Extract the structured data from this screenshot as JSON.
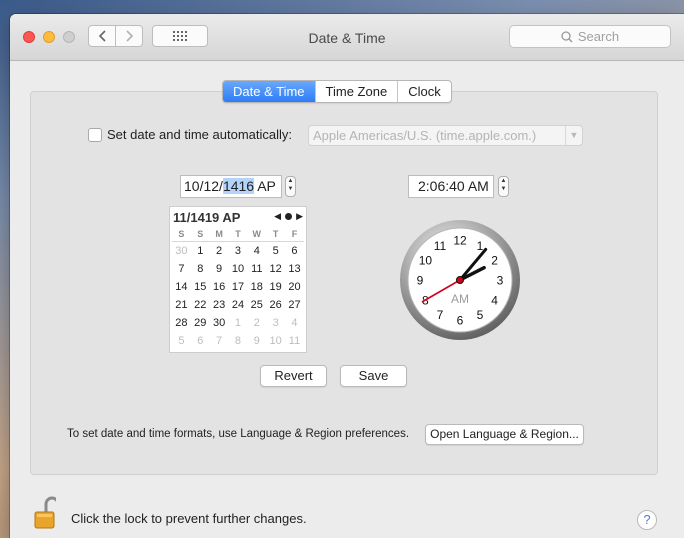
{
  "window": {
    "title": "Date & Time"
  },
  "toolbar": {
    "search_placeholder": "Search"
  },
  "tabs": [
    {
      "label": "Date & Time",
      "active": true
    },
    {
      "label": "Time Zone",
      "active": false
    },
    {
      "label": "Clock",
      "active": false
    }
  ],
  "auto": {
    "checkbox_label": "Set date and time automatically:",
    "checked": false,
    "server": "Apple Americas/U.S. (time.apple.com.)"
  },
  "date": {
    "field_prefix": "10/12/",
    "field_selected": "1416",
    "field_suffix": " AP"
  },
  "time": {
    "field": "2:06:40 AM"
  },
  "calendar": {
    "header": "11/1419 AP",
    "weekdays": [
      "S",
      "S",
      "M",
      "T",
      "W",
      "T",
      "F"
    ],
    "weeks": [
      [
        "30",
        "1",
        "2",
        "3",
        "4",
        "5",
        "6"
      ],
      [
        "7",
        "8",
        "9",
        "10",
        "11",
        "12",
        "13"
      ],
      [
        "14",
        "15",
        "16",
        "17",
        "18",
        "19",
        "20"
      ],
      [
        "21",
        "22",
        "23",
        "24",
        "25",
        "26",
        "27"
      ],
      [
        "28",
        "29",
        "30",
        "1",
        "2",
        "3",
        "4"
      ],
      [
        "5",
        "6",
        "7",
        "8",
        "9",
        "10",
        "11"
      ]
    ],
    "dimmed": [
      [
        0
      ],
      [],
      [],
      [],
      [
        3,
        4,
        5,
        6
      ],
      [
        0,
        1,
        2,
        3,
        4,
        5,
        6
      ]
    ]
  },
  "clock": {
    "numbers": [
      "12",
      "1",
      "2",
      "3",
      "4",
      "5",
      "6",
      "7",
      "8",
      "9",
      "10",
      "11"
    ],
    "period": "AM",
    "hour": 2,
    "minute": 6,
    "second": 40
  },
  "buttons": {
    "revert": "Revert",
    "save": "Save",
    "open_language": "Open Language & Region..."
  },
  "formats_text": "To set date and time formats, use Language & Region preferences.",
  "lock_text": "Click the lock to prevent further changes.",
  "help_label": "?",
  "colors": {
    "accent": "#2d7cf6",
    "second_hand": "#d0021b",
    "close": "#fc5753",
    "minimize": "#fdbc40"
  }
}
